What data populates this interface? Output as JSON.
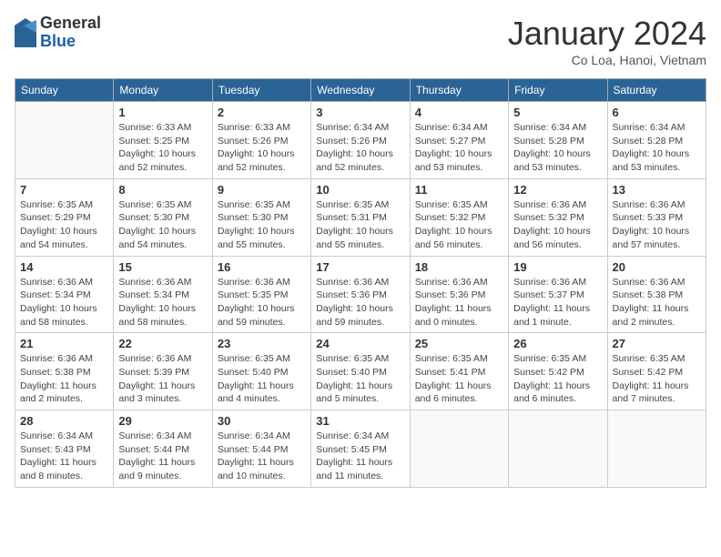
{
  "logo": {
    "general": "General",
    "blue": "Blue"
  },
  "title": "January 2024",
  "location": "Co Loa, Hanoi, Vietnam",
  "weekdays": [
    "Sunday",
    "Monday",
    "Tuesday",
    "Wednesday",
    "Thursday",
    "Friday",
    "Saturday"
  ],
  "weeks": [
    [
      {
        "day": "",
        "info": ""
      },
      {
        "day": "1",
        "info": "Sunrise: 6:33 AM\nSunset: 5:25 PM\nDaylight: 10 hours\nand 52 minutes."
      },
      {
        "day": "2",
        "info": "Sunrise: 6:33 AM\nSunset: 5:26 PM\nDaylight: 10 hours\nand 52 minutes."
      },
      {
        "day": "3",
        "info": "Sunrise: 6:34 AM\nSunset: 5:26 PM\nDaylight: 10 hours\nand 52 minutes."
      },
      {
        "day": "4",
        "info": "Sunrise: 6:34 AM\nSunset: 5:27 PM\nDaylight: 10 hours\nand 53 minutes."
      },
      {
        "day": "5",
        "info": "Sunrise: 6:34 AM\nSunset: 5:28 PM\nDaylight: 10 hours\nand 53 minutes."
      },
      {
        "day": "6",
        "info": "Sunrise: 6:34 AM\nSunset: 5:28 PM\nDaylight: 10 hours\nand 53 minutes."
      }
    ],
    [
      {
        "day": "7",
        "info": "Sunrise: 6:35 AM\nSunset: 5:29 PM\nDaylight: 10 hours\nand 54 minutes."
      },
      {
        "day": "8",
        "info": "Sunrise: 6:35 AM\nSunset: 5:30 PM\nDaylight: 10 hours\nand 54 minutes."
      },
      {
        "day": "9",
        "info": "Sunrise: 6:35 AM\nSunset: 5:30 PM\nDaylight: 10 hours\nand 55 minutes."
      },
      {
        "day": "10",
        "info": "Sunrise: 6:35 AM\nSunset: 5:31 PM\nDaylight: 10 hours\nand 55 minutes."
      },
      {
        "day": "11",
        "info": "Sunrise: 6:35 AM\nSunset: 5:32 PM\nDaylight: 10 hours\nand 56 minutes."
      },
      {
        "day": "12",
        "info": "Sunrise: 6:36 AM\nSunset: 5:32 PM\nDaylight: 10 hours\nand 56 minutes."
      },
      {
        "day": "13",
        "info": "Sunrise: 6:36 AM\nSunset: 5:33 PM\nDaylight: 10 hours\nand 57 minutes."
      }
    ],
    [
      {
        "day": "14",
        "info": "Sunrise: 6:36 AM\nSunset: 5:34 PM\nDaylight: 10 hours\nand 58 minutes."
      },
      {
        "day": "15",
        "info": "Sunrise: 6:36 AM\nSunset: 5:34 PM\nDaylight: 10 hours\nand 58 minutes."
      },
      {
        "day": "16",
        "info": "Sunrise: 6:36 AM\nSunset: 5:35 PM\nDaylight: 10 hours\nand 59 minutes."
      },
      {
        "day": "17",
        "info": "Sunrise: 6:36 AM\nSunset: 5:36 PM\nDaylight: 10 hours\nand 59 minutes."
      },
      {
        "day": "18",
        "info": "Sunrise: 6:36 AM\nSunset: 5:36 PM\nDaylight: 11 hours\nand 0 minutes."
      },
      {
        "day": "19",
        "info": "Sunrise: 6:36 AM\nSunset: 5:37 PM\nDaylight: 11 hours\nand 1 minute."
      },
      {
        "day": "20",
        "info": "Sunrise: 6:36 AM\nSunset: 5:38 PM\nDaylight: 11 hours\nand 2 minutes."
      }
    ],
    [
      {
        "day": "21",
        "info": "Sunrise: 6:36 AM\nSunset: 5:38 PM\nDaylight: 11 hours\nand 2 minutes."
      },
      {
        "day": "22",
        "info": "Sunrise: 6:36 AM\nSunset: 5:39 PM\nDaylight: 11 hours\nand 3 minutes."
      },
      {
        "day": "23",
        "info": "Sunrise: 6:35 AM\nSunset: 5:40 PM\nDaylight: 11 hours\nand 4 minutes."
      },
      {
        "day": "24",
        "info": "Sunrise: 6:35 AM\nSunset: 5:40 PM\nDaylight: 11 hours\nand 5 minutes."
      },
      {
        "day": "25",
        "info": "Sunrise: 6:35 AM\nSunset: 5:41 PM\nDaylight: 11 hours\nand 6 minutes."
      },
      {
        "day": "26",
        "info": "Sunrise: 6:35 AM\nSunset: 5:42 PM\nDaylight: 11 hours\nand 6 minutes."
      },
      {
        "day": "27",
        "info": "Sunrise: 6:35 AM\nSunset: 5:42 PM\nDaylight: 11 hours\nand 7 minutes."
      }
    ],
    [
      {
        "day": "28",
        "info": "Sunrise: 6:34 AM\nSunset: 5:43 PM\nDaylight: 11 hours\nand 8 minutes."
      },
      {
        "day": "29",
        "info": "Sunrise: 6:34 AM\nSunset: 5:44 PM\nDaylight: 11 hours\nand 9 minutes."
      },
      {
        "day": "30",
        "info": "Sunrise: 6:34 AM\nSunset: 5:44 PM\nDaylight: 11 hours\nand 10 minutes."
      },
      {
        "day": "31",
        "info": "Sunrise: 6:34 AM\nSunset: 5:45 PM\nDaylight: 11 hours\nand 11 minutes."
      },
      {
        "day": "",
        "info": ""
      },
      {
        "day": "",
        "info": ""
      },
      {
        "day": "",
        "info": ""
      }
    ]
  ]
}
